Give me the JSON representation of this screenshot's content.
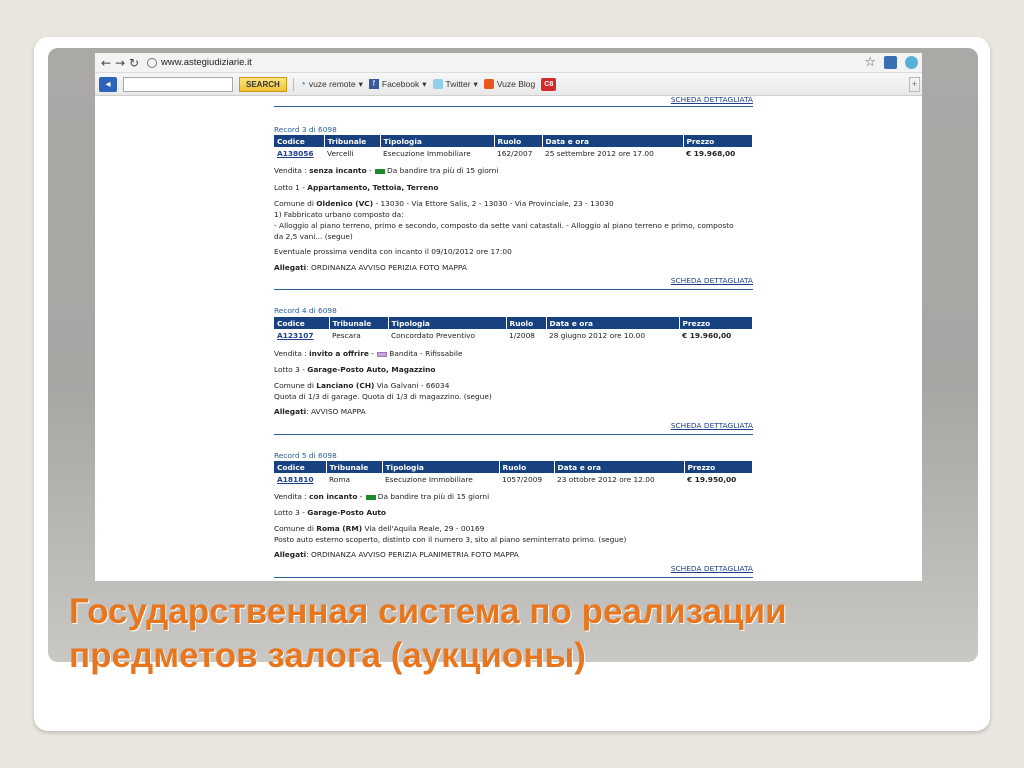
{
  "browser": {
    "url": "www.astegiudiziarie.it",
    "toolbar": {
      "search_label": "SEARCH",
      "vuze_remote": "vuze remote",
      "facebook": "Facebook",
      "twitter": "Twitter",
      "vuze_blog": "Vuze Blog",
      "c8_label": "C8"
    }
  },
  "top_link": "SCHEDA DETTAGLIATA",
  "headers": [
    "Codice",
    "Tribunale",
    "Tipologia",
    "Ruolo",
    "Data e ora",
    "Prezzo"
  ],
  "records": [
    {
      "title": "Record 3 di 6098",
      "row": [
        "A138056",
        "Vercelli",
        "Esecuzione Immobiliare",
        "162/2007",
        "25 settembre 2012 ore 17.00",
        "€ 19.968,00"
      ],
      "vendita_prefix": "Vendita : ",
      "vendita_type": "senza incanto",
      "vendita_sep": " - ",
      "status_text": "Da bandire tra più di 15 giorni",
      "lotto_prefix": "Lotto 1 - ",
      "lotto_name": "Appartamento, Tettoia, Terreno",
      "comune_prefix": "Comune di ",
      "comune_name": "Oldenico (VC)",
      "comune_rest": " - 13030 - Via Ettore Salis, 2 - 13030 - Via Provinciale, 23 - 13030",
      "desc": [
        "1) Fabbricato urbano composto da:",
        "- Alloggio al piano terreno, primo e secondo, composto da sette vani catastali. - Alloggio al piano terreno e primo, composto",
        "da 2,5 vani... (segue)"
      ],
      "extra": "Eventuale prossima vendita con incanto il 09/10/2012 ore 17:00",
      "allegati_label": "Allegati",
      "allegati": ":    ORDINANZA AVVISO PERIZIA FOTO MAPPA",
      "link": "SCHEDA DETTAGLIATA"
    },
    {
      "title": "Record 4 di 6098",
      "row": [
        "A123107",
        "Pescara",
        "Concordato Preventivo",
        "1/2008",
        "28 giugno 2012 ore 10.00",
        "€ 19.960,00"
      ],
      "vendita_prefix": "Vendita : ",
      "vendita_type": "invito a offrire",
      "vendita_sep": " - ",
      "status_text": "Bandita - Rifissabile",
      "lotto_prefix": "Lotto 3 - ",
      "lotto_name": "Garage-Posto Auto, Magazzino",
      "comune_prefix": "Comune di ",
      "comune_name": "Lanciano (CH)",
      "comune_rest": " Via Galvani - 66034",
      "desc": [
        "Quota di 1/3 di garage. Quota di 1/3 di magazzino. (segue)"
      ],
      "allegati_label": "Allegati",
      "allegati": ":    AVVISO MAPPA",
      "link": "SCHEDA DETTAGLIATA"
    },
    {
      "title": "Record 5 di 6098",
      "row": [
        "A181810",
        "Roma",
        "Esecuzione Immobiliare",
        "1057/2009",
        "23 ottobre 2012 ore 12.00",
        "€ 19.950,00"
      ],
      "vendita_prefix": "Vendita : ",
      "vendita_type": "con incanto",
      "vendita_sep": " - ",
      "status_text": "Da bandire tra più di 15 giorni",
      "lotto_prefix": "Lotto 3 - ",
      "lotto_name": "Garage-Posto Auto",
      "comune_prefix": "Comune di ",
      "comune_name": "Roma (RM)",
      "comune_rest": " Via dell'Aquila Reale, 29 - 00169",
      "desc": [
        "Posto auto esterno scoperto, distinto con il numero 3, sito al piano seminterrato primo. (segue)"
      ],
      "allegati_label": "Allegati",
      "allegati": ":    ORDINANZA AVVISO PERIZIA PLANIMETRIA FOTO MAPPA",
      "link": "SCHEDA DETTAGLIATA"
    }
  ],
  "slide_title": "Государственная система по реализации предметов залога (аукционы)",
  "colors": {
    "accent": "#e8761f",
    "table_header": "#17427f",
    "link": "#1f3f8a",
    "status_green": "#1d8a2e",
    "status_lilac": "#c7a4db"
  }
}
